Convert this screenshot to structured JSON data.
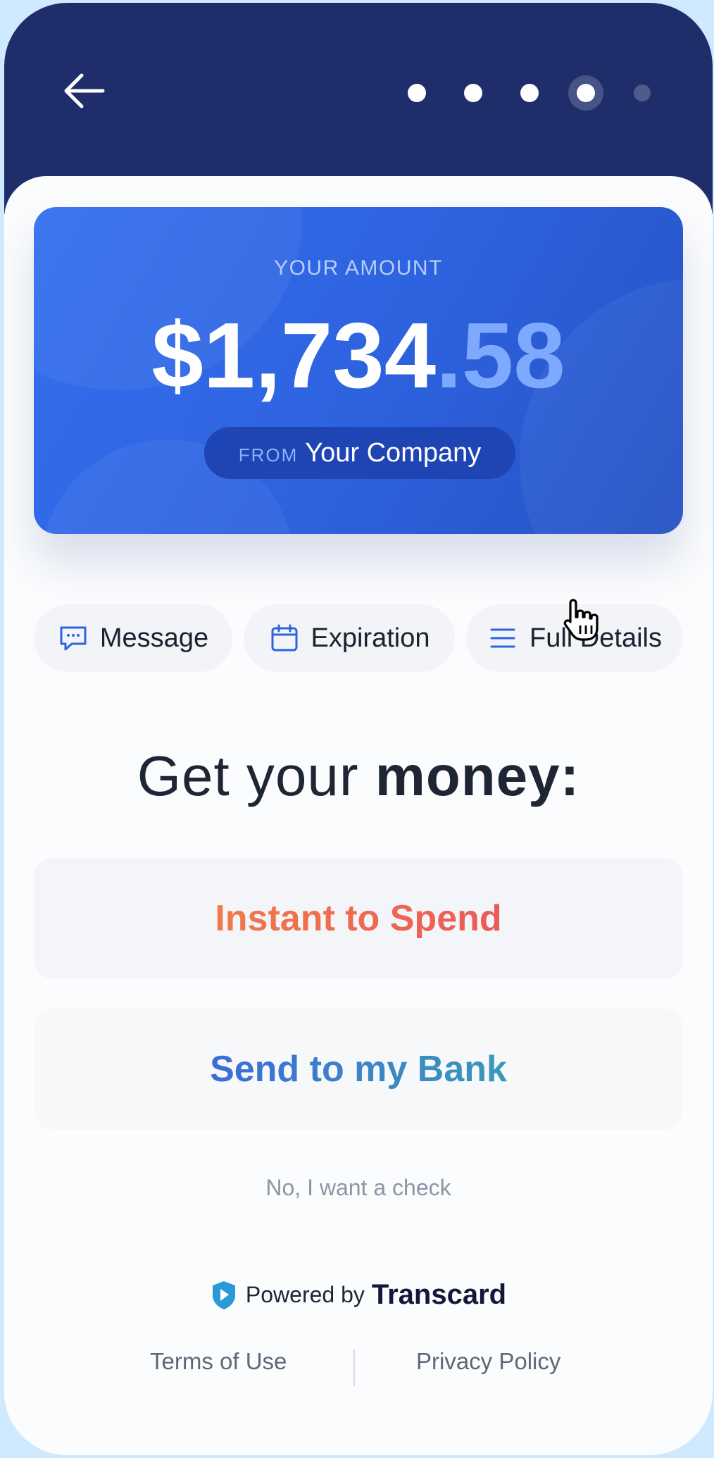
{
  "header": {
    "progress": {
      "total_steps": 5,
      "current_step": 4
    }
  },
  "amount_card": {
    "label": "YOUR AMOUNT",
    "amount_main": "$1,734",
    "amount_cents": ".58",
    "from_label": "FROM",
    "from_name": "Your Company"
  },
  "chips": [
    {
      "label": "Message",
      "icon": "chat-icon"
    },
    {
      "label": "Expiration",
      "icon": "calendar-icon"
    },
    {
      "label": "Full Details",
      "icon": "list-icon"
    }
  ],
  "headline": {
    "prefix": "Get your",
    "emphasis": "money:"
  },
  "options": {
    "instant": "Instant to Spend",
    "bank": "Send to my Bank",
    "check": "No, I want a check"
  },
  "footer": {
    "powered_by": "Powered by",
    "brand": "Transcard",
    "terms": "Terms of Use",
    "privacy": "Privacy Policy"
  },
  "colors": {
    "header": "#1f2d6b",
    "card": "#2e63e0",
    "instant_gradient": [
      "#f07a4a",
      "#ec5a58"
    ],
    "bank_gradient": [
      "#3d6cd8",
      "#3a9ab6"
    ]
  }
}
